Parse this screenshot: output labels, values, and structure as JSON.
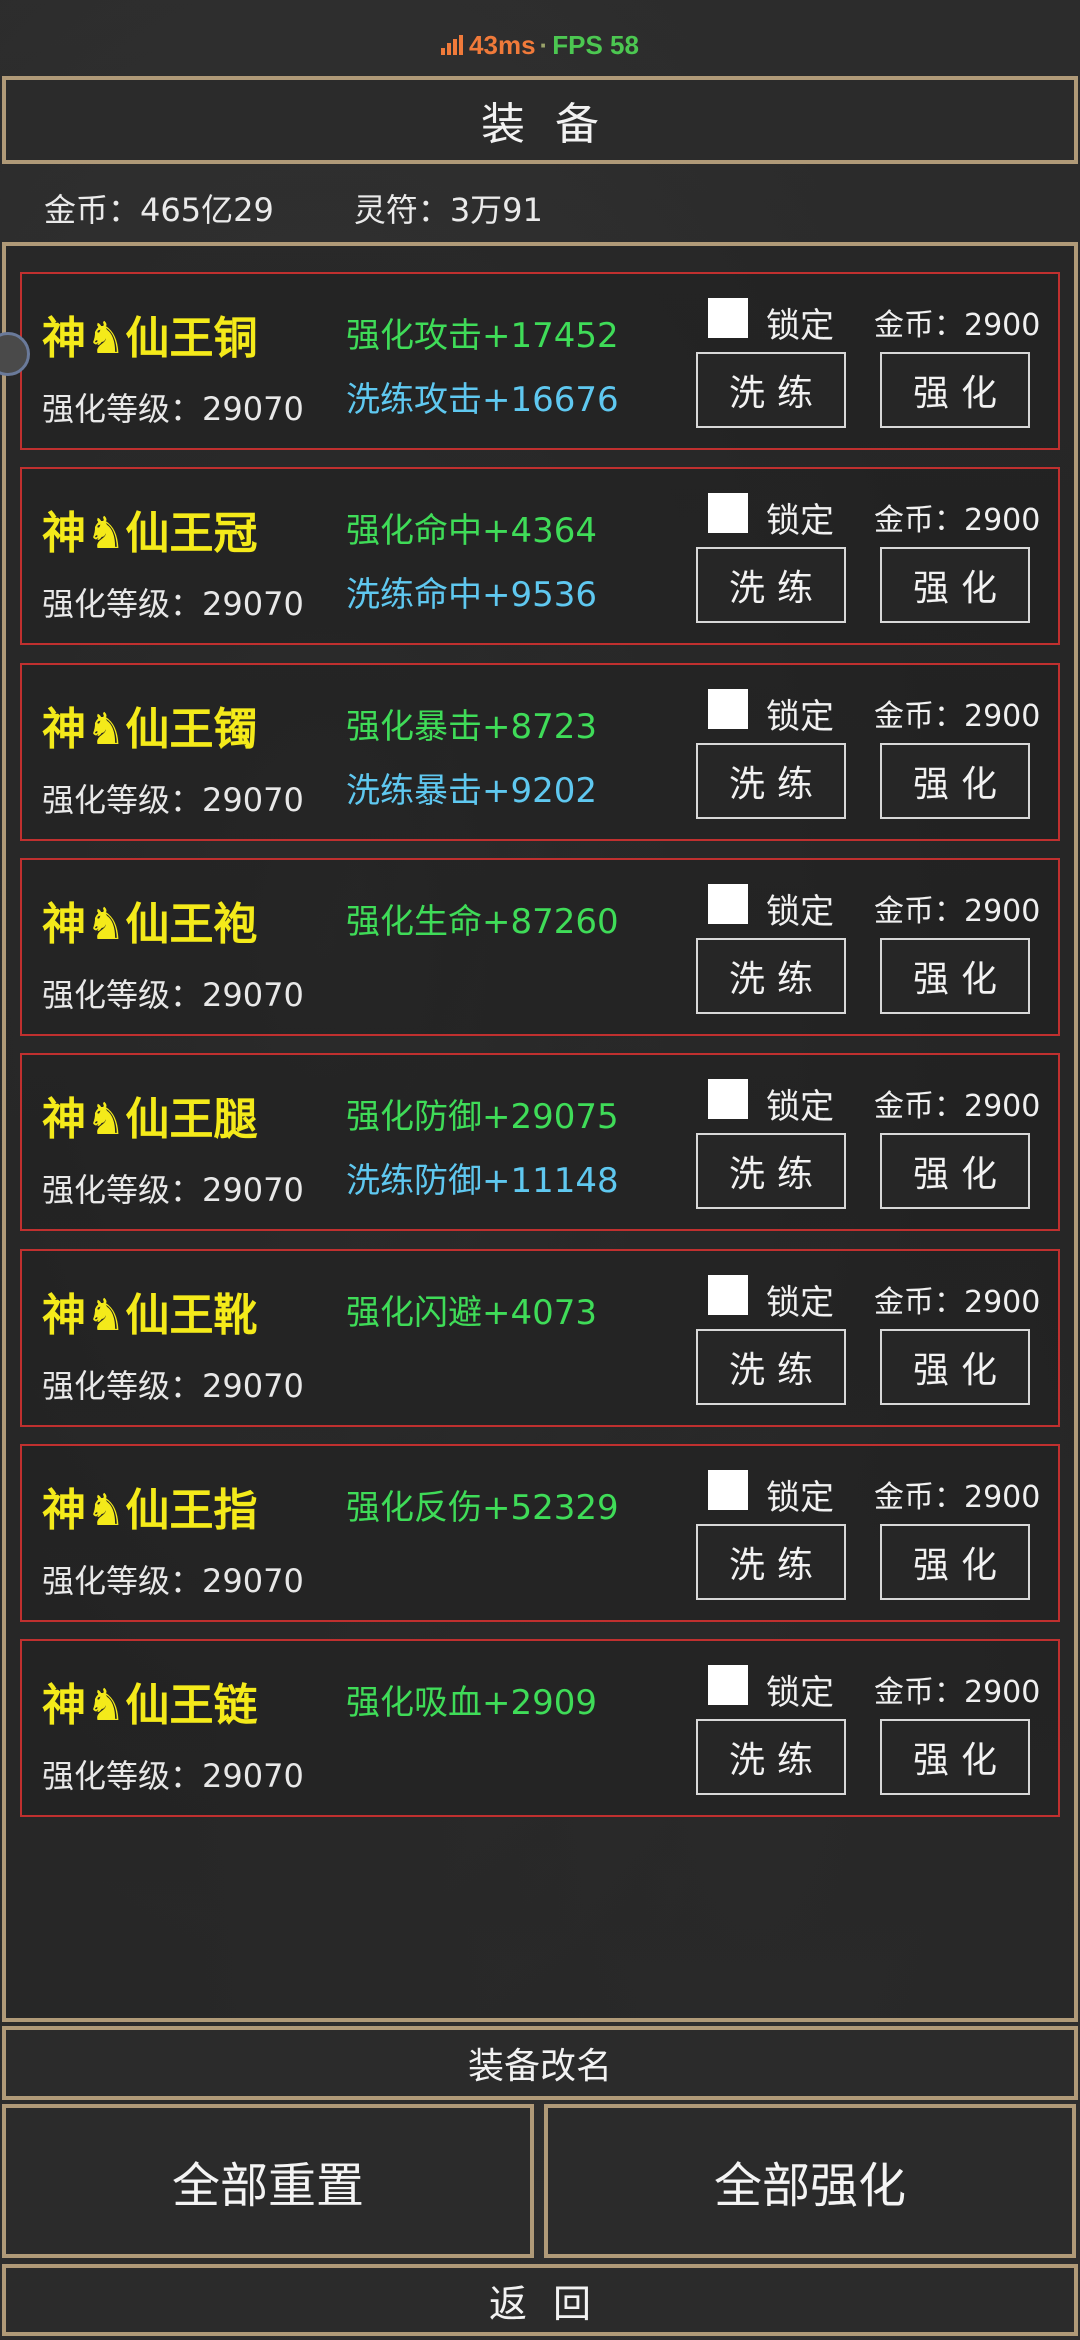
{
  "status": {
    "ping": "43ms",
    "separator": "·",
    "fps": "FPS 58"
  },
  "title": "装备",
  "currency": {
    "gold": "金币：465亿29",
    "talisman": "灵符：3万91"
  },
  "lock_label": "锁定",
  "wash_label": "洗练",
  "strengthen_label": "强化",
  "items": [
    {
      "name": "神♞仙王铜",
      "level": "强化等级：29070",
      "stat1": "强化攻击+17452",
      "stat2": "洗练攻击+16676",
      "gold": "金币：2900"
    },
    {
      "name": "神♞仙王冠",
      "level": "强化等级：29070",
      "stat1": "强化命中+4364",
      "stat2": "洗练命中+9536",
      "gold": "金币：2900"
    },
    {
      "name": "神♞仙王镯",
      "level": "强化等级：29070",
      "stat1": "强化暴击+8723",
      "stat2": "洗练暴击+9202",
      "gold": "金币：2900"
    },
    {
      "name": "神♞仙王袍",
      "level": "强化等级：29070",
      "stat1": "强化生命+87260",
      "stat2": "",
      "gold": "金币：2900"
    },
    {
      "name": "神♞仙王腿",
      "level": "强化等级：29070",
      "stat1": "强化防御+29075",
      "stat2": "洗练防御+11148",
      "gold": "金币：2900"
    },
    {
      "name": "神♞仙王靴",
      "level": "强化等级：29070",
      "stat1": "强化闪避+4073",
      "stat2": "",
      "gold": "金币：2900"
    },
    {
      "name": "神♞仙王指",
      "level": "强化等级：29070",
      "stat1": "强化反伤+52329",
      "stat2": "",
      "gold": "金币：2900"
    },
    {
      "name": "神♞仙王链",
      "level": "强化等级：29070",
      "stat1": "强化吸血+2909",
      "stat2": "",
      "gold": "金币：2900"
    }
  ],
  "footer": {
    "rename": "装备改名",
    "reset_all": "全部重置",
    "strengthen_all": "全部强化",
    "back": "返回"
  },
  "colors": {
    "border_gold": "#b09a78",
    "card_border": "#c0302f",
    "item_name": "#f4ea1a",
    "stat_strengthen": "#3fdc58",
    "stat_wash": "#5fc8f0",
    "ping": "#f07a3a",
    "fps": "#4cc751"
  },
  "icons": {
    "signal": "signal-bars-icon",
    "checkbox": "checkbox-icon"
  }
}
